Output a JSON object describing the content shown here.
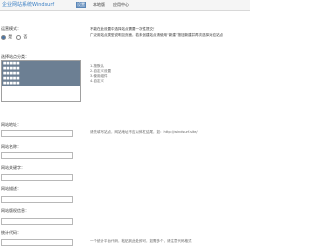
{
  "header": {
    "brand": "企业网站系统Windsurf",
    "tabs": [
      {
        "label": "设置",
        "active": true
      },
      {
        "label": "本地版",
        "active": false
      },
      {
        "label": "应用中心",
        "active": false
      }
    ]
  },
  "form": {
    "mode_label": "运营模式：",
    "mode_options": [
      {
        "label": "是",
        "checked": true
      },
      {
        "label": "否",
        "checked": false
      }
    ],
    "list_label": "选择站点分类：",
    "list_items": [
      "■■■■■",
      "■■■■■",
      "■■■■■",
      "■■■■■",
      "■■■■■",
      "",
      "",
      ""
    ],
    "list_hints": [
      "1-按默认",
      "2-自定义设置",
      "3-使用组件",
      "4-自定义"
    ],
    "notice_lines": [
      "不能在此设置中选择站点需要一次性提交！",
      "广泛用站点类型说明见页面，若未创建站点请使用“新建”按钮新建并再次选择对应站点"
    ],
    "fields": [
      {
        "label": "网站地址：",
        "value": "",
        "hint": "请先填写站点，网站地址不应以斜杠结尾，如：http://windsurf.site/"
      },
      {
        "label": "网站名称：",
        "value": "",
        "hint": ""
      },
      {
        "label": "网站关键字：",
        "value": "",
        "hint": ""
      },
      {
        "label": "网站描述：",
        "value": "",
        "hint": ""
      },
      {
        "label": "网站版权信息：",
        "value": "",
        "hint": ""
      },
      {
        "label": "统计代码：",
        "value": "",
        "hint": "一个统计平台代码，粘贴到此处即可，如需多个，请注意代码格式"
      }
    ]
  }
}
